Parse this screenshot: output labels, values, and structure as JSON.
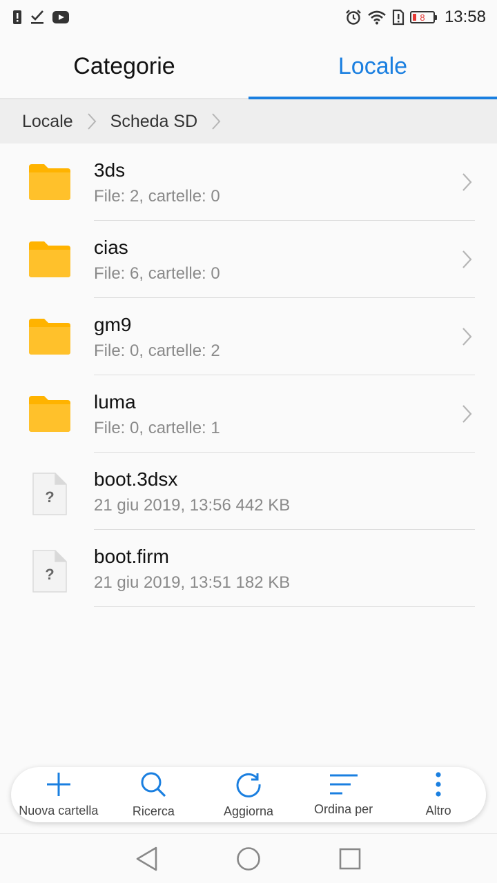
{
  "status_bar": {
    "left_icons": [
      "alert-icon",
      "check-icon",
      "youtube-icon"
    ],
    "right_icons": [
      "alarm-icon",
      "wifi-icon",
      "sim-alert-icon"
    ],
    "battery_level": "8",
    "time": "13:58"
  },
  "tabs": [
    {
      "label": "Categorie",
      "active": false
    },
    {
      "label": "Locale",
      "active": true
    }
  ],
  "breadcrumb": [
    "Locale",
    "Scheda SD"
  ],
  "files": [
    {
      "type": "folder",
      "name": "3ds",
      "detail": "File: 2, cartelle: 0"
    },
    {
      "type": "folder",
      "name": "cias",
      "detail": "File: 6, cartelle: 0"
    },
    {
      "type": "folder",
      "name": "gm9",
      "detail": "File: 0, cartelle: 2"
    },
    {
      "type": "folder",
      "name": "luma",
      "detail": "File: 0, cartelle: 1"
    },
    {
      "type": "file",
      "name": "boot.3dsx",
      "detail": "21 giu 2019, 13:56 442 KB"
    },
    {
      "type": "file",
      "name": "boot.firm",
      "detail": "21 giu 2019, 13:51 182 KB"
    }
  ],
  "toolbar": {
    "new_folder": "Nuova cartella",
    "search": "Ricerca",
    "refresh": "Aggiorna",
    "sort": "Ordina per",
    "more": "Altro"
  },
  "colors": {
    "accent": "#1a7fe0",
    "folder": "#ffc12b",
    "battery_low": "#e53935"
  }
}
